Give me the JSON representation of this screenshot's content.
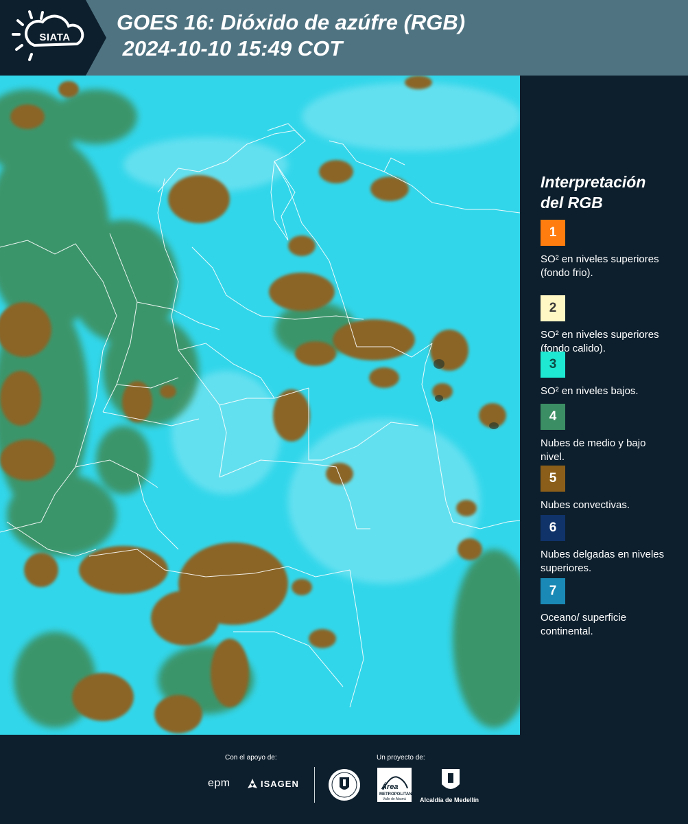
{
  "header": {
    "logo_text": "SIATA",
    "title_line1": "GOES 16: Dióxido de azúfre (RGB)",
    "title_line2": " 2024-10-10 15:49 COT",
    "background_color": "#4f7381"
  },
  "map": {
    "description_colors": {
      "background": "#2fd8ec",
      "convective": "#8d6a2a",
      "mid_low_clouds": "#3f8c52",
      "borders": "#ffffff"
    }
  },
  "legend": {
    "title_line1": "Interpretación",
    "title_line2": "del RGB",
    "items": [
      {
        "number": "1",
        "color": "#ff7d0f",
        "text_color": "#ffffff",
        "label": "SO² en niveles superiores (fondo frio)."
      },
      {
        "number": "2",
        "color": "#fff7c4",
        "text_color": "#3a3a3a",
        "label": "SO² en niveles superiores (fondo calido)."
      },
      {
        "number": "3",
        "color": "#1ee8d2",
        "text_color": "#0d4a44",
        "label": "SO² en niveles bajos."
      },
      {
        "number": "4",
        "color": "#3b8e63",
        "text_color": "#ffffff",
        "label": "Nubes de medio y bajo nivel."
      },
      {
        "number": "5",
        "color": "#8b5f19",
        "text_color": "#ffffff",
        "label": "Nubes convectivas."
      },
      {
        "number": "6",
        "color": "#10336a",
        "text_color": "#ffffff",
        "label": "Nubes delgadas en niveles superiores."
      },
      {
        "number": "7",
        "color": "#1a89b5",
        "text_color": "#ffffff",
        "label": "Oceano/ superficie continental."
      }
    ]
  },
  "footer": {
    "support_label": "Con el apoyo de:",
    "project_label": "Un proyecto de:",
    "sponsor_epm": "epm",
    "sponsor_isagen": "ISAGEN",
    "area_line1": "Área",
    "area_line2": "METROPOLITANA",
    "area_line3": "Valle de Aburrá",
    "alcaldia": "Alcaldía de Medellín"
  }
}
